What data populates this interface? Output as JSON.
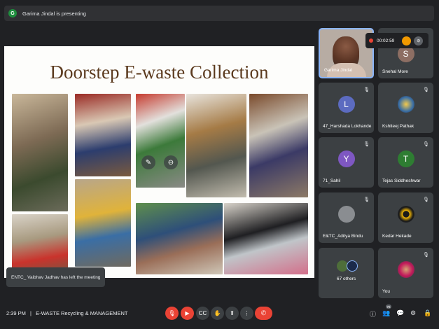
{
  "presenting": {
    "avatar_letter": "G",
    "text": "Garima Jindal is presenting"
  },
  "slide": {
    "title": "Doorstep E-waste Collection"
  },
  "toast": "ENTC_ Vaibhav Jadhav has left the meeting",
  "recording": {
    "time": "00:02:59"
  },
  "tiles": [
    {
      "name": "Garima Jindal",
      "type": "self"
    },
    {
      "name": "Snehal More",
      "letter": "S",
      "color": "#8d6e63"
    },
    {
      "name": "47_Harshada Lokhande",
      "letter": "L",
      "color": "#5c6bc0"
    },
    {
      "name": "Kshiteej Pathak",
      "type": "photo"
    },
    {
      "name": "71_Sahil",
      "letter": "Y",
      "color": "#7e57c2"
    },
    {
      "name": "Tejas Siddheshwar",
      "letter": "T",
      "color": "#2e7d32"
    },
    {
      "name": "E&TC_Aditya Bindu",
      "type": "generic"
    },
    {
      "name": "Kedar Hekade",
      "type": "logo"
    },
    {
      "name": "67 others",
      "type": "others"
    },
    {
      "name": "You",
      "type": "photo2"
    }
  ],
  "bottom": {
    "time": "2:39 PM",
    "separator": "|",
    "meeting": "E-WASTE Recycling & MANAGEMENT",
    "people_count": "76"
  },
  "colors": {
    "end_call": "#ea4335",
    "accent": "#8ab4f8",
    "background": "#202124"
  }
}
